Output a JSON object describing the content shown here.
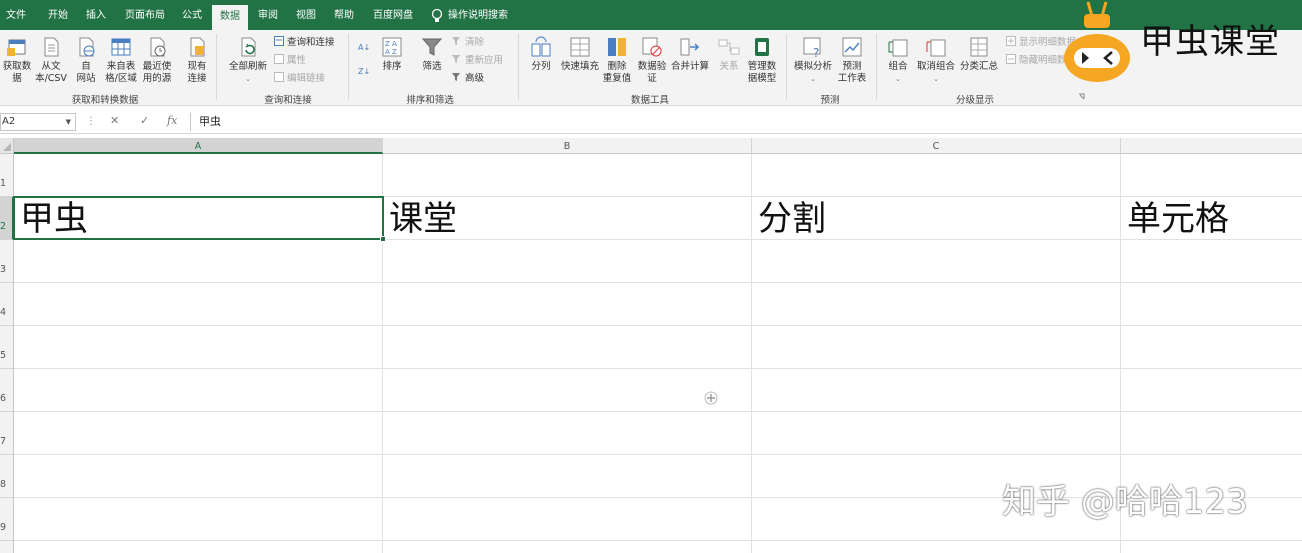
{
  "ribbon_tabs": [
    {
      "label": "文件"
    },
    {
      "label": "开始"
    },
    {
      "label": "插入"
    },
    {
      "label": "页面布局"
    },
    {
      "label": "公式"
    },
    {
      "label": "数据"
    },
    {
      "label": "审阅"
    },
    {
      "label": "视图"
    },
    {
      "label": "帮助"
    },
    {
      "label": "百度网盘"
    },
    {
      "label": "操作说明搜索"
    }
  ],
  "active_tab": "数据",
  "ribbon": {
    "get_data": {
      "line1": "获取数",
      "line2": "据"
    },
    "from_csv": {
      "line1": "从文",
      "line2": "本/CSV"
    },
    "from_web": {
      "line1": "自",
      "line2": "网站"
    },
    "from_table": {
      "line1": "来自表",
      "line2": "格/区域"
    },
    "recent_sources": {
      "line1": "最近使",
      "line2": "用的源"
    },
    "existing_conn": {
      "line1": "现有",
      "line2": "连接"
    },
    "group1_label": "获取和转换数据",
    "refresh_all": "全部刷新",
    "queries_conn": "查询和连接",
    "properties": "属性",
    "edit_links": "编辑链接",
    "group2_label": "查询和连接",
    "sort": "排序",
    "filter": "筛选",
    "clear": "清除",
    "reapply": "重新应用",
    "advanced": "高级",
    "group3_label": "排序和筛选",
    "text_to_columns": "分列",
    "flash_fill": "快速填充",
    "remove_dup": {
      "line1": "删除",
      "line2": "重复值"
    },
    "data_validation": {
      "line1": "数据验",
      "line2": "证"
    },
    "consolidate": "合并计算",
    "relationships": "关系",
    "data_model": {
      "line1": "管理数",
      "line2": "据模型"
    },
    "group4_label": "数据工具",
    "what_if": "模拟分析",
    "forecast": {
      "line1": "预测",
      "line2": "工作表"
    },
    "group5_label": "预测",
    "group": "组合",
    "ungroup": "取消组合",
    "subtotal": "分类汇总",
    "show_detail": "显示明细数据",
    "hide_detail": "隐藏明细数据",
    "group6_label": "分级显示"
  },
  "formula_bar": {
    "name_box": "A2",
    "fx": "fx",
    "content": "甲虫"
  },
  "columns": [
    "A",
    "B",
    "C"
  ],
  "rows": [
    "1",
    "2",
    "3",
    "4",
    "5",
    "6",
    "7",
    "8",
    "9"
  ],
  "cells": {
    "A2": "甲虫",
    "B2": "课堂",
    "C2": "分割",
    "D2": "单元格"
  },
  "overlay": {
    "brand": "甲虫课堂",
    "watermark": "知乎 @哈哈123"
  },
  "colors": {
    "accent": "#217346",
    "logo_orange": "#f5a623"
  }
}
